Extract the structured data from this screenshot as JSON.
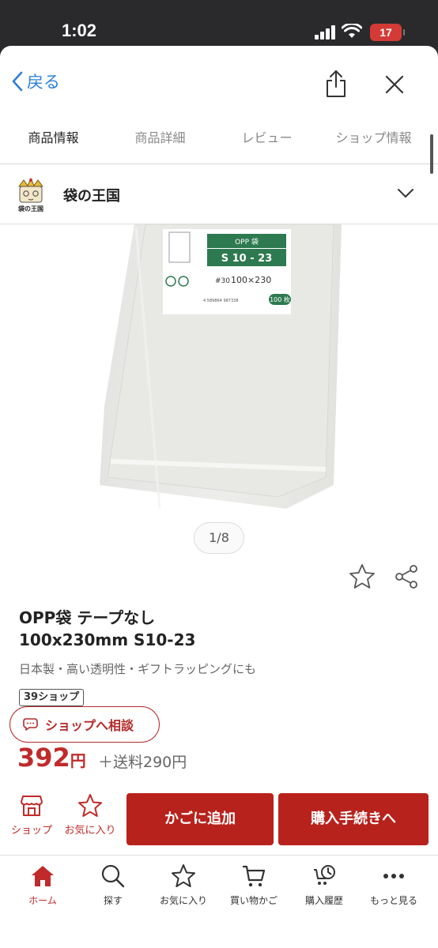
{
  "status_bar": {
    "time": "1:02",
    "battery": "17"
  },
  "nav": {
    "back_label": "戻る"
  },
  "tabs": [
    {
      "label": "商品情報",
      "active": true
    },
    {
      "label": "商品詳細",
      "active": false
    },
    {
      "label": "レビュー",
      "active": false
    },
    {
      "label": "ショップ情報",
      "active": false
    }
  ],
  "shop": {
    "name": "袋の王国",
    "logo_text": "袋の王国"
  },
  "product_image": {
    "label_title": "OPP 袋",
    "label_code": "S 10 - 23",
    "label_thickness": "#30",
    "label_size": "100×230",
    "label_count": "100 枚",
    "label_barcode": "4 589864 987338"
  },
  "pager": "1/8",
  "product": {
    "title_line1": "OPP袋 テープなし",
    "title_line2": "100x230mm S10-23",
    "subtitle": "日本製・高い透明性・ギフトラッピングにも",
    "badge": "39ショップ",
    "consult_label": "ショップへ相談",
    "price": "392",
    "price_unit": "円",
    "shipping": "＋送料290円"
  },
  "actions": {
    "shop_label": "ショップ",
    "favorite_label": "お気に入り",
    "cart_label": "かごに追加",
    "buy_label": "購入手続きへ"
  },
  "tab_bar": [
    {
      "label": "ホーム",
      "icon": "home-icon",
      "active": true
    },
    {
      "label": "探す",
      "icon": "search-icon",
      "active": false
    },
    {
      "label": "お気に入り",
      "icon": "star-icon",
      "active": false
    },
    {
      "label": "買い物かご",
      "icon": "cart-icon",
      "active": false
    },
    {
      "label": "購入履歴",
      "icon": "history-icon",
      "active": false
    },
    {
      "label": "もっと見る",
      "icon": "more-icon",
      "active": false
    }
  ],
  "colors": {
    "accent": "#b8221c",
    "link": "#2b7fd8",
    "label_green": "#2e7a50"
  }
}
